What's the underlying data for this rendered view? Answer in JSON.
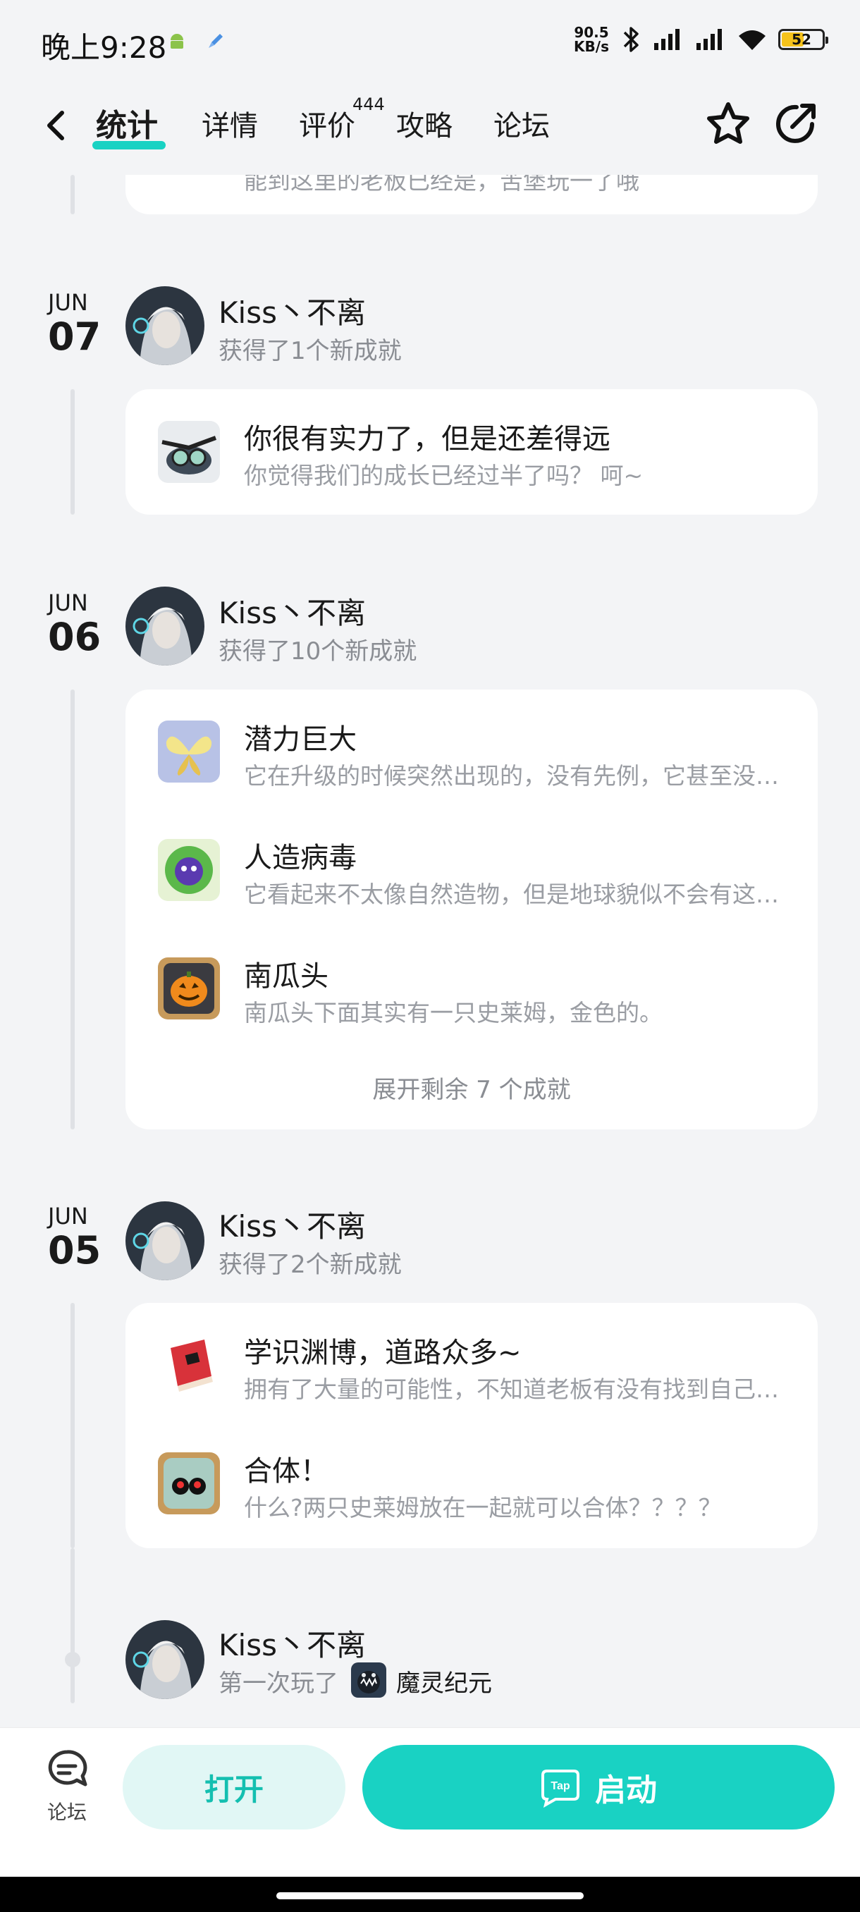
{
  "status_bar": {
    "time": "晚上9:28",
    "net_speed_top": "90.5",
    "net_speed_unit": "KB/s",
    "battery": "52"
  },
  "header": {
    "tabs": [
      {
        "label": "统计"
      },
      {
        "label": "详情"
      },
      {
        "label": "评价"
      },
      {
        "label": "攻略"
      },
      {
        "label": "论坛"
      }
    ],
    "review_count": "444"
  },
  "timeline": {
    "top_partial_desc": "能到这里的老板已经是，苦堡玩一了哦",
    "entries": [
      {
        "month": "JUN",
        "day": "07",
        "user": "Kiss丶不离",
        "summary": "获得了1个新成就",
        "achievements": [
          {
            "title": "你很有实力了，但是还差得远",
            "desc": "你觉得我们的成长已经过半了吗？ 呵~",
            "icon": "ninja-goggles-icon"
          }
        ]
      },
      {
        "month": "JUN",
        "day": "06",
        "user": "Kiss丶不离",
        "summary": "获得了10个新成就",
        "achievements": [
          {
            "title": "潜力巨大",
            "desc": "它在升级的时候突然出现的，没有先例，它甚至没有名字",
            "icon": "butterfly-icon"
          },
          {
            "title": "人造病毒",
            "desc": "它看起来不太像自然造物，但是地球貌似不会有这种东西",
            "icon": "virus-icon"
          },
          {
            "title": "南瓜头",
            "desc": "南瓜头下面其实有一只史莱姆，金色的。",
            "icon": "pumpkin-icon"
          }
        ],
        "expand_label": "展开剩余 7 个成就"
      },
      {
        "month": "JUN",
        "day": "05",
        "user": "Kiss丶不离",
        "summary": "获得了2个新成就",
        "achievements": [
          {
            "title": "学识渊博，道路众多~",
            "desc": "拥有了大量的可能性，不知道老板有没有找到自己的路",
            "icon": "red-book-icon"
          },
          {
            "title": "合体！",
            "desc": "什么?两只史莱姆放在一起就可以合体？？？？",
            "icon": "twin-slime-icon"
          }
        ]
      },
      {
        "user": "Kiss丶不离",
        "summary_prefix": "第一次玩了",
        "game_name": "魔灵纪元"
      }
    ]
  },
  "bottom_bar": {
    "forum_label": "论坛",
    "open_label": "打开",
    "launch_label": "启动",
    "launch_badge": "Tap"
  },
  "colors": {
    "accent": "#19d2c3",
    "accent_light": "#e1f7f5",
    "background": "#f3f4f6"
  }
}
